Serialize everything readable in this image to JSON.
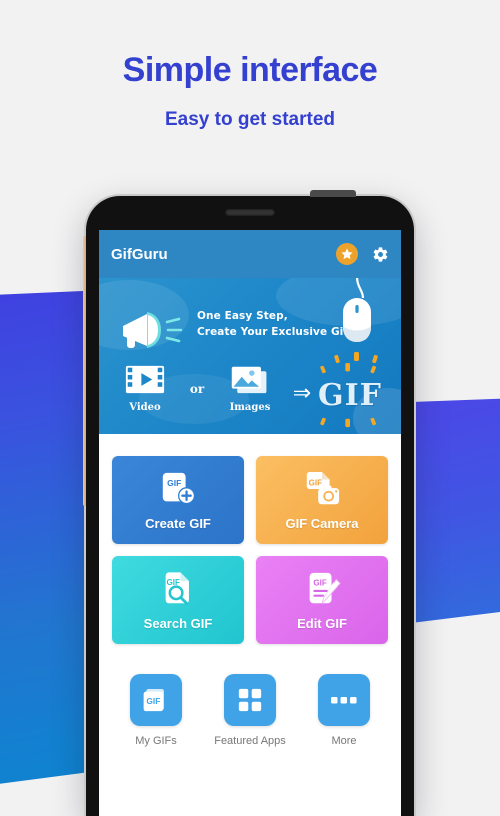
{
  "background": {
    "page_color": "#f2f2f2",
    "shape_left_color": "#3a52df",
    "shape_right_color": "#4340e4"
  },
  "promo": {
    "headline": "Simple interface",
    "subheadline": "Easy to get started",
    "headline_color": "#3440cf"
  },
  "app": {
    "bar": {
      "title": "GifGuru",
      "bar_color": "#2e86c3",
      "star_badge": {
        "icon": "star-icon",
        "circle_color": "#eda32b"
      },
      "settings": {
        "icon": "gear-icon",
        "color": "#ffffff"
      }
    },
    "banner": {
      "line1": "One Easy Step,",
      "line2": "Create Your Exclusive Gif !",
      "megaphone_icon": "megaphone-icon",
      "mouse_icon": "computer-mouse-icon",
      "spark_color": "#f5a623",
      "flow": {
        "video_label": "Video",
        "video_icon": "film-strip-play-icon",
        "connector": "or",
        "images_label": "Images",
        "images_icon": "photo-stack-icon",
        "arrow": "⇒",
        "result": "GIF"
      },
      "bg_color": "#1d87c9"
    },
    "tiles": [
      {
        "label": "Create GIF",
        "icon": "gif-document-plus-icon",
        "color": "#2f7fd4",
        "gradient": "linear-gradient(135deg,#3b86d8,#2b74c9)"
      },
      {
        "label": "GIF Camera",
        "icon": "gif-document-camera-icon",
        "color": "#f6b04f",
        "gradient": "linear-gradient(135deg,#fbbf63,#f2a23c)"
      },
      {
        "label": "Search GIF",
        "icon": "gif-document-search-icon",
        "color": "#2ed0d8",
        "gradient": "linear-gradient(135deg,#3fdbe0,#21c4cf)"
      },
      {
        "label": "Edit GIF",
        "icon": "gif-document-pencil-icon",
        "color": "#e171ef",
        "gradient": "linear-gradient(135deg,#ea81f5,#d965ea)"
      }
    ],
    "shortcuts": [
      {
        "label": "My GIFs",
        "icon": "gif-folder-icon",
        "tile_color": "#40a3e8"
      },
      {
        "label": "Featured Apps",
        "icon": "grid-squares-icon",
        "tile_color": "#40a3e8"
      },
      {
        "label": "More",
        "icon": "ellipsis-icon",
        "tile_color": "#40a3e8"
      }
    ]
  }
}
